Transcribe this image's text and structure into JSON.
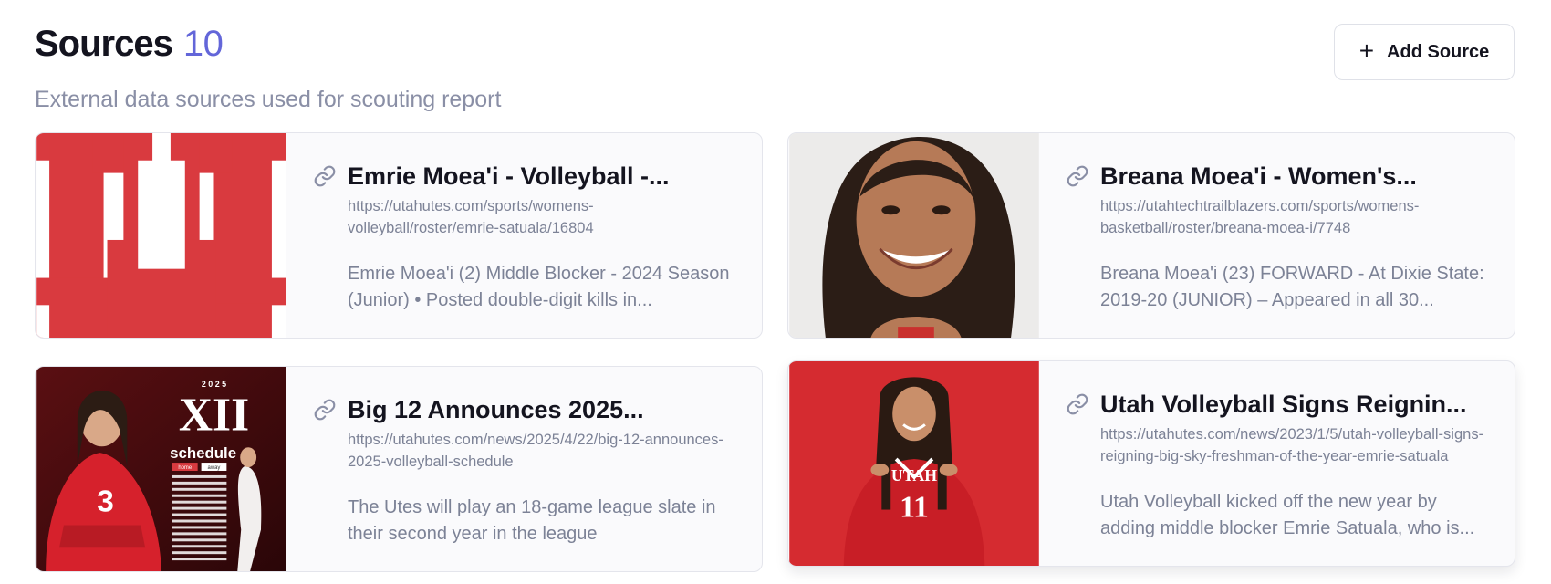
{
  "header": {
    "title": "Sources",
    "count": "10",
    "subtitle": "External data sources used for scouting report"
  },
  "actions": {
    "add_source_label": "Add Source",
    "add_source_icon": "plus-icon"
  },
  "colors": {
    "accent": "#6366d9",
    "utah_red": "#d93a3f",
    "muted_text": "#7c8296"
  },
  "cards": [
    {
      "title": "Emrie Moea'i - Volleyball -...",
      "url": "https://utahutes.com/sports/womens-volleyball/roster/emrie-satuala/16804",
      "description": "Emrie Moea'i (2) Middle Blocker - 2024 Season (Junior) • Posted double-digit kills in...",
      "icon": "link-icon",
      "thumbnail": "utah-block-u-logo"
    },
    {
      "title": "Breana Moea'i - Women's...",
      "url": "https://utahtechtrailblazers.com/sports/womens-basketball/roster/breana-moea-i/7748",
      "description": "Breana Moea'i (23) FORWARD - At Dixie State: 2019-20 (JUNIOR) – Appeared in all 30...",
      "icon": "link-icon",
      "thumbnail": "player-headshot-photo"
    },
    {
      "title": "Big 12 Announces 2025...",
      "url": "https://utahutes.com/news/2025/4/22/big-12-announces-2025-volleyball-schedule",
      "description": "The Utes will play an 18-game league slate in their second year in the league",
      "icon": "link-icon",
      "thumbnail": "schedule-graphic",
      "thumbnail_text": {
        "year": "2 0 2 5",
        "logo": "XII",
        "heading": "schedule",
        "home": "home",
        "away": "away",
        "jersey": "3"
      }
    },
    {
      "title": "Utah Volleyball Signs Reignin...",
      "url": "https://utahutes.com/news/2023/1/5/utah-volleyball-signs-reigning-big-sky-freshman-of-the-year-emrie-satuala",
      "description": "Utah Volleyball kicked off the new year by adding middle blocker Emrie Satuala, who is...",
      "icon": "link-icon",
      "thumbnail": "player-jersey-photo",
      "thumbnail_text": {
        "jersey_name": "UTAH",
        "jersey_number": "11"
      }
    }
  ]
}
